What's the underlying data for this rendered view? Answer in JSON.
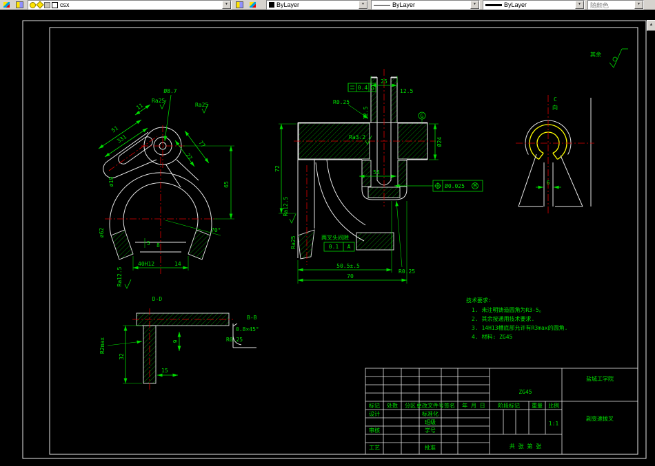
{
  "toolbar": {
    "layer_combo": {
      "value": "csx"
    },
    "color_combo": {
      "value": "ByLayer"
    },
    "linetype_combo": {
      "value": "ByLayer"
    },
    "lineweight_combo": {
      "value": "ByLayer"
    },
    "plot_style_combo": {
      "value": "随颜色"
    }
  },
  "drawing": {
    "finish_note": {
      "label": "其余"
    },
    "tech_requirements": {
      "title": "技术要求:",
      "items": [
        "1. 未注明铸造圆角为R3-5。",
        "2. 其余按通用技术要求.",
        "3. 14H13槽底部允许有R3max的圆角.",
        "4. 材料: ZG45"
      ]
    },
    "view1": {
      "hole_dia": "Ø8.7",
      "len_51": "51",
      "len_331": "331",
      "len_11": "11",
      "len_77": "77",
      "len_27": "27",
      "height_65": "65",
      "angle_70": "70°",
      "dia_62": "ø62",
      "dia_19": "ø19",
      "gap_5": "5",
      "gap_8": "8",
      "slot_40": "40H12",
      "slot_14": "14",
      "ra_left": "Ra25",
      "ra_right": "Ra25",
      "ra_bottom": "Ra12.5"
    },
    "view2": {
      "width_25": "25",
      "dia_125_top": "12.5",
      "dia_125_bore": "12.5",
      "fcf_parallel": {
        "value": "0.4",
        "datum": "G"
      },
      "r_fillet_top": "R0.25",
      "ra_32": "Ra3.2",
      "datum_circle": "G",
      "dia_24": "Ø24",
      "fcf_position": {
        "value": "Ø0.025",
        "modifier": "M"
      },
      "len_54": "54",
      "gap_note": "两叉头间隙",
      "fcf_runout": {
        "value": "0.1",
        "datum": "A"
      },
      "len_505": "50.5±.5",
      "len_70": "70",
      "height_72": "72",
      "ra_125": "Ra12.5",
      "ra_25": "Ra25",
      "r_fillet_bottom": "R0.25"
    },
    "view3": {
      "label_c": "C",
      "label_dir": "向",
      "slot_6": "6"
    },
    "view4": {
      "label": "D-D",
      "height_32": "32",
      "len_15": "15",
      "thk_9": "9",
      "r2max": "R2max",
      "detail_label": "B-B",
      "chamfer": "0.8×45°",
      "r_025": "R0.25"
    }
  },
  "title_block": {
    "rev_headers": [
      "标记",
      "处数",
      "分区",
      "更改文件号",
      "签名",
      "年 月 日"
    ],
    "row_design": "设计",
    "row_check": "审核",
    "row_process": "工艺",
    "col_std": "标准化",
    "col_class": "班级",
    "col_no": "学号",
    "col_approve": "批准",
    "material": "ZG45",
    "stage_label": "阶段标记",
    "weight_label": "重量",
    "scale_label": "比例",
    "scale_value": "1:1",
    "sheet_text": "共    张 第    张",
    "school": "盐城工学院",
    "part_name": "副变速拨叉"
  }
}
